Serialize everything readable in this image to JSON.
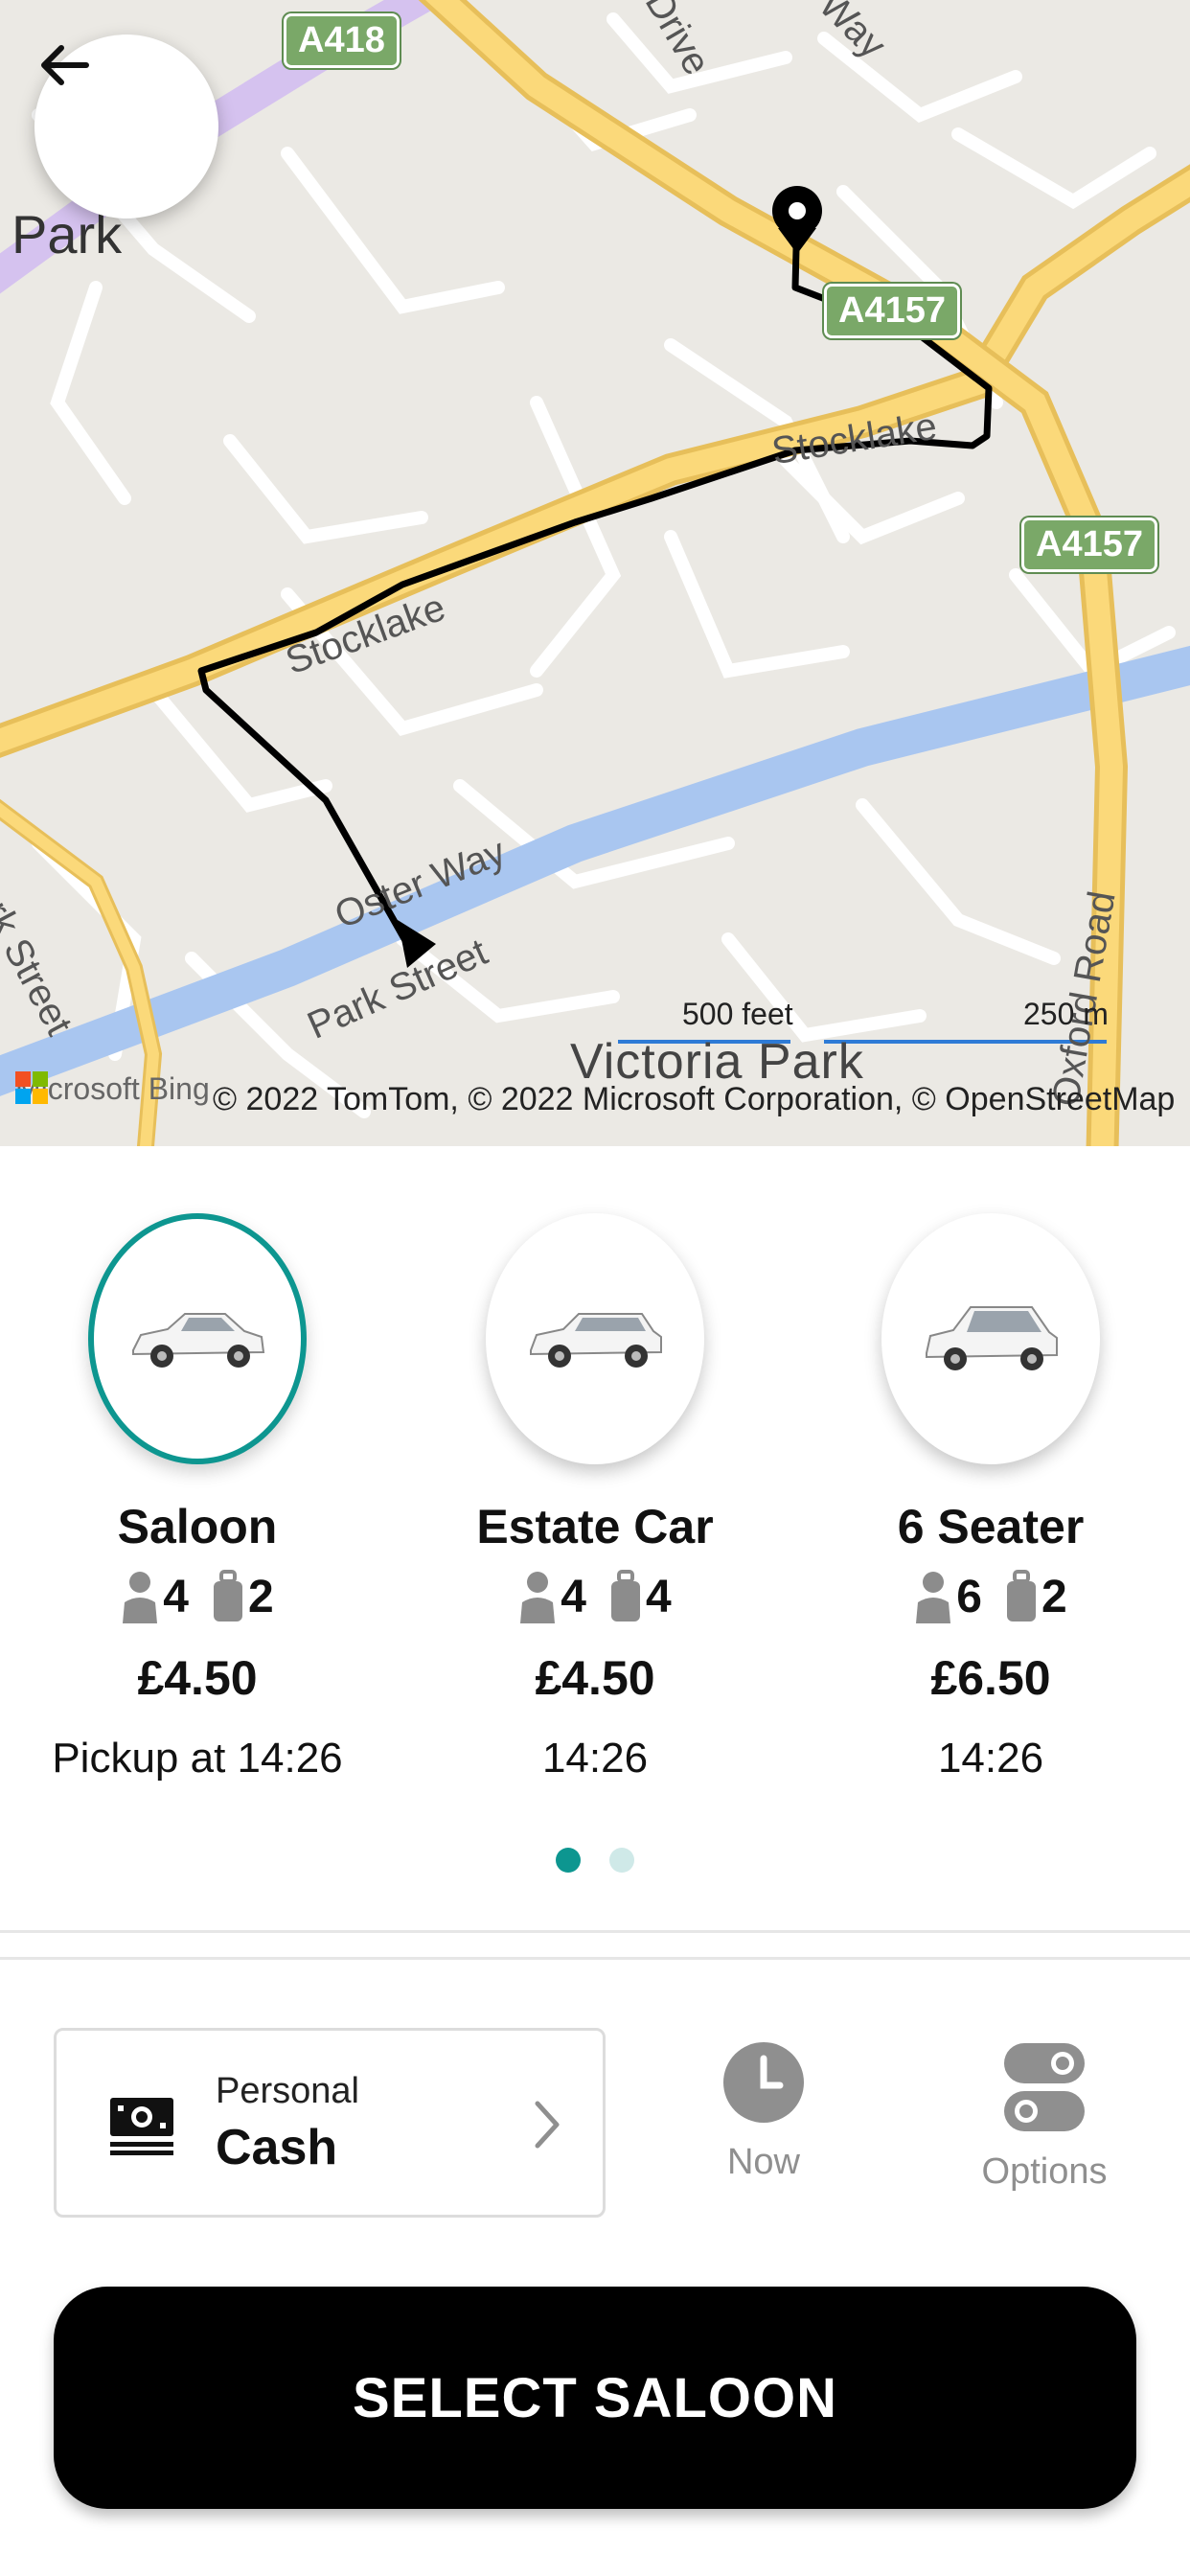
{
  "map": {
    "road_shields": [
      "A418",
      "A4157",
      "A4157"
    ],
    "street_labels": [
      "Stocklake",
      "Stocklake",
      "Park Street",
      "Oster Way",
      "Park Street",
      "Oxford Road",
      "Drive",
      "Way",
      "Park"
    ],
    "place_label": "Victoria Park",
    "scale_feet": "500 feet",
    "scale_meters": "250 m",
    "bing_label": "Microsoft Bing",
    "attribution": "© 2022 TomTom, © 2022 Microsoft Corporation, © OpenStreetMap",
    "back_icon": "arrow-left-icon"
  },
  "vehicles": [
    {
      "name": "Saloon",
      "passengers": "4",
      "luggage": "2",
      "price": "£4.50",
      "time": "Pickup at  14:26",
      "selected": true
    },
    {
      "name": "Estate Car",
      "passengers": "4",
      "luggage": "4",
      "price": "£4.50",
      "time": "14:26",
      "selected": false
    },
    {
      "name": "6 Seater",
      "passengers": "6",
      "luggage": "2",
      "price": "£6.50",
      "time": "14:26",
      "selected": false
    }
  ],
  "pagination": {
    "pages": 2,
    "active": 0
  },
  "payment": {
    "subtitle": "Personal",
    "method": "Cash",
    "icon": "cash-icon"
  },
  "controls": {
    "now_label": "Now",
    "options_label": "Options"
  },
  "action": {
    "button_label": "SELECT SALOON"
  },
  "colors": {
    "accent": "#0d9690",
    "button": "#000000",
    "route": "#000000"
  }
}
